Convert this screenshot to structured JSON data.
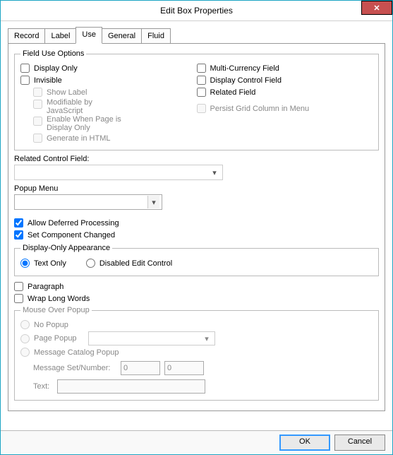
{
  "window": {
    "title": "Edit Box Properties"
  },
  "tabs": {
    "record": "Record",
    "label": "Label",
    "use": "Use",
    "general": "General",
    "fluid": "Fluid"
  },
  "fieldUse": {
    "legend": "Field Use Options",
    "displayOnly": "Display Only",
    "invisible": "Invisible",
    "showLabel": "Show Label",
    "modifiableByJS": "Modifiable by JavaScript",
    "enableWhenPageDO": "Enable When Page is Display Only",
    "generateInHTML": "Generate in HTML",
    "multiCurrency": "Multi-Currency Field",
    "displayControl": "Display Control Field",
    "relatedField": "Related Field",
    "persistGrid": "Persist Grid Column in Menu"
  },
  "relatedControl": {
    "label": "Related Control Field:",
    "value": ""
  },
  "popupMenu": {
    "label": "Popup Menu",
    "value": ""
  },
  "allowDeferred": {
    "label": "Allow Deferred Processing",
    "checked": true
  },
  "setComponentChanged": {
    "label": "Set Component Changed",
    "checked": true
  },
  "displayOnlyAppearance": {
    "legend": "Display-Only Appearance",
    "textOnly": "Text Only",
    "disabledEdit": "Disabled Edit Control"
  },
  "paragraph": {
    "label": "Paragraph"
  },
  "wrapLongWords": {
    "label": "Wrap Long Words"
  },
  "mouseOver": {
    "legend": "Mouse Over Popup",
    "noPopup": "No Popup",
    "pagePopup": "Page Popup",
    "messageCatalog": "Message Catalog Popup",
    "msgSetNumLabel": "Message Set/Number:",
    "msgSet": "0",
    "msgNum": "0",
    "textLabel": "Text:",
    "textValue": ""
  },
  "buttons": {
    "ok": "OK",
    "cancel": "Cancel"
  }
}
